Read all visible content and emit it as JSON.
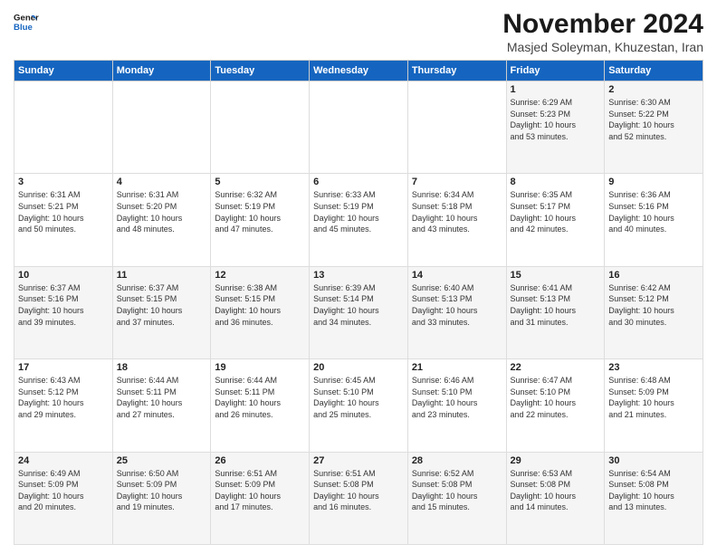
{
  "header": {
    "logo_line1": "General",
    "logo_line2": "Blue",
    "title": "November 2024",
    "subtitle": "Masjed Soleyman, Khuzestan, Iran"
  },
  "weekdays": [
    "Sunday",
    "Monday",
    "Tuesday",
    "Wednesday",
    "Thursday",
    "Friday",
    "Saturday"
  ],
  "weeks": [
    [
      {
        "day": "",
        "info": ""
      },
      {
        "day": "",
        "info": ""
      },
      {
        "day": "",
        "info": ""
      },
      {
        "day": "",
        "info": ""
      },
      {
        "day": "",
        "info": ""
      },
      {
        "day": "1",
        "info": "Sunrise: 6:29 AM\nSunset: 5:23 PM\nDaylight: 10 hours\nand 53 minutes."
      },
      {
        "day": "2",
        "info": "Sunrise: 6:30 AM\nSunset: 5:22 PM\nDaylight: 10 hours\nand 52 minutes."
      }
    ],
    [
      {
        "day": "3",
        "info": "Sunrise: 6:31 AM\nSunset: 5:21 PM\nDaylight: 10 hours\nand 50 minutes."
      },
      {
        "day": "4",
        "info": "Sunrise: 6:31 AM\nSunset: 5:20 PM\nDaylight: 10 hours\nand 48 minutes."
      },
      {
        "day": "5",
        "info": "Sunrise: 6:32 AM\nSunset: 5:19 PM\nDaylight: 10 hours\nand 47 minutes."
      },
      {
        "day": "6",
        "info": "Sunrise: 6:33 AM\nSunset: 5:19 PM\nDaylight: 10 hours\nand 45 minutes."
      },
      {
        "day": "7",
        "info": "Sunrise: 6:34 AM\nSunset: 5:18 PM\nDaylight: 10 hours\nand 43 minutes."
      },
      {
        "day": "8",
        "info": "Sunrise: 6:35 AM\nSunset: 5:17 PM\nDaylight: 10 hours\nand 42 minutes."
      },
      {
        "day": "9",
        "info": "Sunrise: 6:36 AM\nSunset: 5:16 PM\nDaylight: 10 hours\nand 40 minutes."
      }
    ],
    [
      {
        "day": "10",
        "info": "Sunrise: 6:37 AM\nSunset: 5:16 PM\nDaylight: 10 hours\nand 39 minutes."
      },
      {
        "day": "11",
        "info": "Sunrise: 6:37 AM\nSunset: 5:15 PM\nDaylight: 10 hours\nand 37 minutes."
      },
      {
        "day": "12",
        "info": "Sunrise: 6:38 AM\nSunset: 5:15 PM\nDaylight: 10 hours\nand 36 minutes."
      },
      {
        "day": "13",
        "info": "Sunrise: 6:39 AM\nSunset: 5:14 PM\nDaylight: 10 hours\nand 34 minutes."
      },
      {
        "day": "14",
        "info": "Sunrise: 6:40 AM\nSunset: 5:13 PM\nDaylight: 10 hours\nand 33 minutes."
      },
      {
        "day": "15",
        "info": "Sunrise: 6:41 AM\nSunset: 5:13 PM\nDaylight: 10 hours\nand 31 minutes."
      },
      {
        "day": "16",
        "info": "Sunrise: 6:42 AM\nSunset: 5:12 PM\nDaylight: 10 hours\nand 30 minutes."
      }
    ],
    [
      {
        "day": "17",
        "info": "Sunrise: 6:43 AM\nSunset: 5:12 PM\nDaylight: 10 hours\nand 29 minutes."
      },
      {
        "day": "18",
        "info": "Sunrise: 6:44 AM\nSunset: 5:11 PM\nDaylight: 10 hours\nand 27 minutes."
      },
      {
        "day": "19",
        "info": "Sunrise: 6:44 AM\nSunset: 5:11 PM\nDaylight: 10 hours\nand 26 minutes."
      },
      {
        "day": "20",
        "info": "Sunrise: 6:45 AM\nSunset: 5:10 PM\nDaylight: 10 hours\nand 25 minutes."
      },
      {
        "day": "21",
        "info": "Sunrise: 6:46 AM\nSunset: 5:10 PM\nDaylight: 10 hours\nand 23 minutes."
      },
      {
        "day": "22",
        "info": "Sunrise: 6:47 AM\nSunset: 5:10 PM\nDaylight: 10 hours\nand 22 minutes."
      },
      {
        "day": "23",
        "info": "Sunrise: 6:48 AM\nSunset: 5:09 PM\nDaylight: 10 hours\nand 21 minutes."
      }
    ],
    [
      {
        "day": "24",
        "info": "Sunrise: 6:49 AM\nSunset: 5:09 PM\nDaylight: 10 hours\nand 20 minutes."
      },
      {
        "day": "25",
        "info": "Sunrise: 6:50 AM\nSunset: 5:09 PM\nDaylight: 10 hours\nand 19 minutes."
      },
      {
        "day": "26",
        "info": "Sunrise: 6:51 AM\nSunset: 5:09 PM\nDaylight: 10 hours\nand 17 minutes."
      },
      {
        "day": "27",
        "info": "Sunrise: 6:51 AM\nSunset: 5:08 PM\nDaylight: 10 hours\nand 16 minutes."
      },
      {
        "day": "28",
        "info": "Sunrise: 6:52 AM\nSunset: 5:08 PM\nDaylight: 10 hours\nand 15 minutes."
      },
      {
        "day": "29",
        "info": "Sunrise: 6:53 AM\nSunset: 5:08 PM\nDaylight: 10 hours\nand 14 minutes."
      },
      {
        "day": "30",
        "info": "Sunrise: 6:54 AM\nSunset: 5:08 PM\nDaylight: 10 hours\nand 13 minutes."
      }
    ]
  ]
}
